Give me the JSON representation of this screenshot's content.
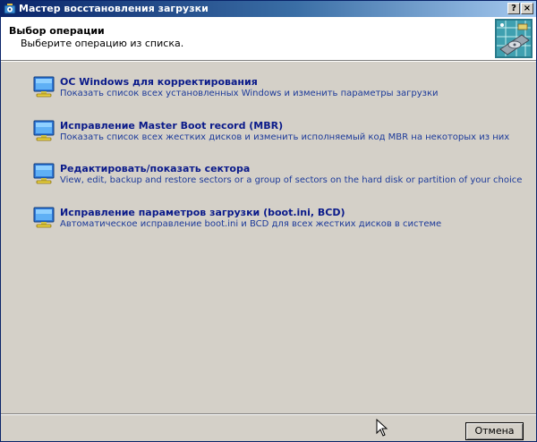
{
  "window": {
    "title": "Мастер восстановления загрузки",
    "help_glyph": "?",
    "close_glyph": "×"
  },
  "header": {
    "title": "Выбор операции",
    "subtitle": "Выберите операцию из списка.",
    "image": "hard-disk-image"
  },
  "options": [
    {
      "title": "ОС Windows для корректирования",
      "description": "Показать список всех установленных Windows и изменить параметры загрузки",
      "icon": "monitor-icon"
    },
    {
      "title": "Исправление Master Boot record (MBR)",
      "description": "Показать список всех жестких дисков и изменить исполняемый код MBR на некоторых из них",
      "icon": "monitor-icon"
    },
    {
      "title": "Редактировать/показать сектора",
      "description": "View, edit, backup and restore sectors or a group of sectors on the hard disk or partition of your choice",
      "icon": "monitor-icon"
    },
    {
      "title": "Исправление параметров загрузки (boot.ini, BCD)",
      "description": "Автоматическое исправление boot.ini и BCD для всех жестких дисков в системе",
      "icon": "monitor-icon"
    }
  ],
  "footer": {
    "cancel_label": "Отмена"
  },
  "colors": {
    "titlebar_start": "#0a246a",
    "titlebar_end": "#a6caf0",
    "option_title": "#0a1a8a",
    "face": "#d4d0c8"
  }
}
